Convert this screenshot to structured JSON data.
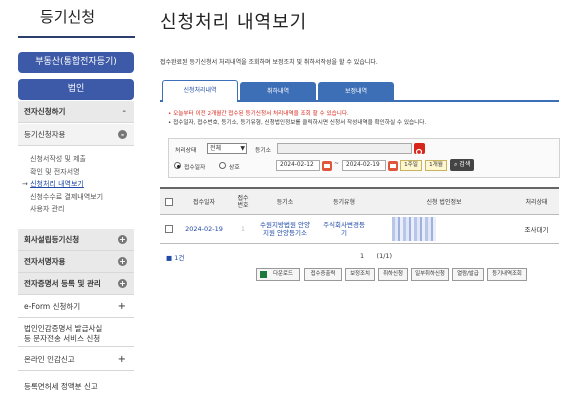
{
  "sidebar": {
    "title": "등기신청",
    "btn_real_estate": "부동산(통합전자등기)",
    "btn_corp": "법인",
    "sections": [
      {
        "label": "전자신청하기",
        "marker": "-"
      },
      {
        "label": "등기신청자용",
        "marker": "-"
      }
    ],
    "sub_items": [
      "신청서작성 및 제출",
      "확인 및 전자서명",
      "신청처리 내역보기",
      "신청수수료 결제내역보기",
      "사용자 관리"
    ],
    "current_prefix": "→",
    "groups": [
      {
        "label": "회사설립등기신청",
        "marker": "+"
      },
      {
        "label": "전자서명자용",
        "marker": "+"
      },
      {
        "label": "전자증명서 등록 및 관리",
        "marker": "+"
      }
    ],
    "plain_items": [
      {
        "label": "e-Form 신청하기",
        "marker": "+"
      },
      {
        "label": "법인인감증명서 발급사실\n등 문자전송 서비스 신청",
        "marker": ""
      },
      {
        "label": "온라인 인감신고",
        "marker": "+"
      },
      {
        "label": "등록면허세 정액분 신고",
        "marker": ""
      }
    ]
  },
  "main": {
    "title": "신청처리 내역보기",
    "description": "접수완료된 등기신청서 처리내역을 조회하며 보정조치 및 취하서작성을 할 수 있습니다.",
    "tabs": [
      "신청처리내역",
      "취하내역",
      "보정내역"
    ],
    "notes": {
      "red": "• 오늘부터 이전 2개월간 접수된 등기신청서 처리내역을 조회 할 수 있습니다.",
      "gray": "• 접수일자, 접수번호, 등기소, 등기유형, 신청법인정보를 클릭하시면 신청서 작성내역을 확인하실 수 있습니다."
    },
    "search": {
      "status_label": "처리상태",
      "status_value": "전체",
      "office_label": "등기소",
      "radio_date": "접수일자",
      "radio_trade": "상호",
      "date_from": "2024-02-12",
      "date_sep": "~",
      "date_to": "2024-02-19",
      "btn_1week": "1주일",
      "btn_1month": "1개월",
      "btn_search": "검색"
    },
    "table": {
      "headers": [
        "접수일자",
        "접수\n번호",
        "등기소",
        "등기유형",
        "신청 법인정보",
        "처리상태"
      ],
      "rows": [
        {
          "date": "2024-02-19",
          "number": "1",
          "office": "수원지방법원 안양\n지원 안양등기소",
          "type": "주식회사변경등\n기",
          "corp": "",
          "status": "조사대기"
        }
      ]
    },
    "total_label": "1건",
    "pagination": "1      (1/1)",
    "actions": [
      "다운로드",
      "접수증출력",
      "보정조치",
      "취하신청",
      "일부취하신청",
      "열람/발급",
      "등기내역조회"
    ]
  }
}
